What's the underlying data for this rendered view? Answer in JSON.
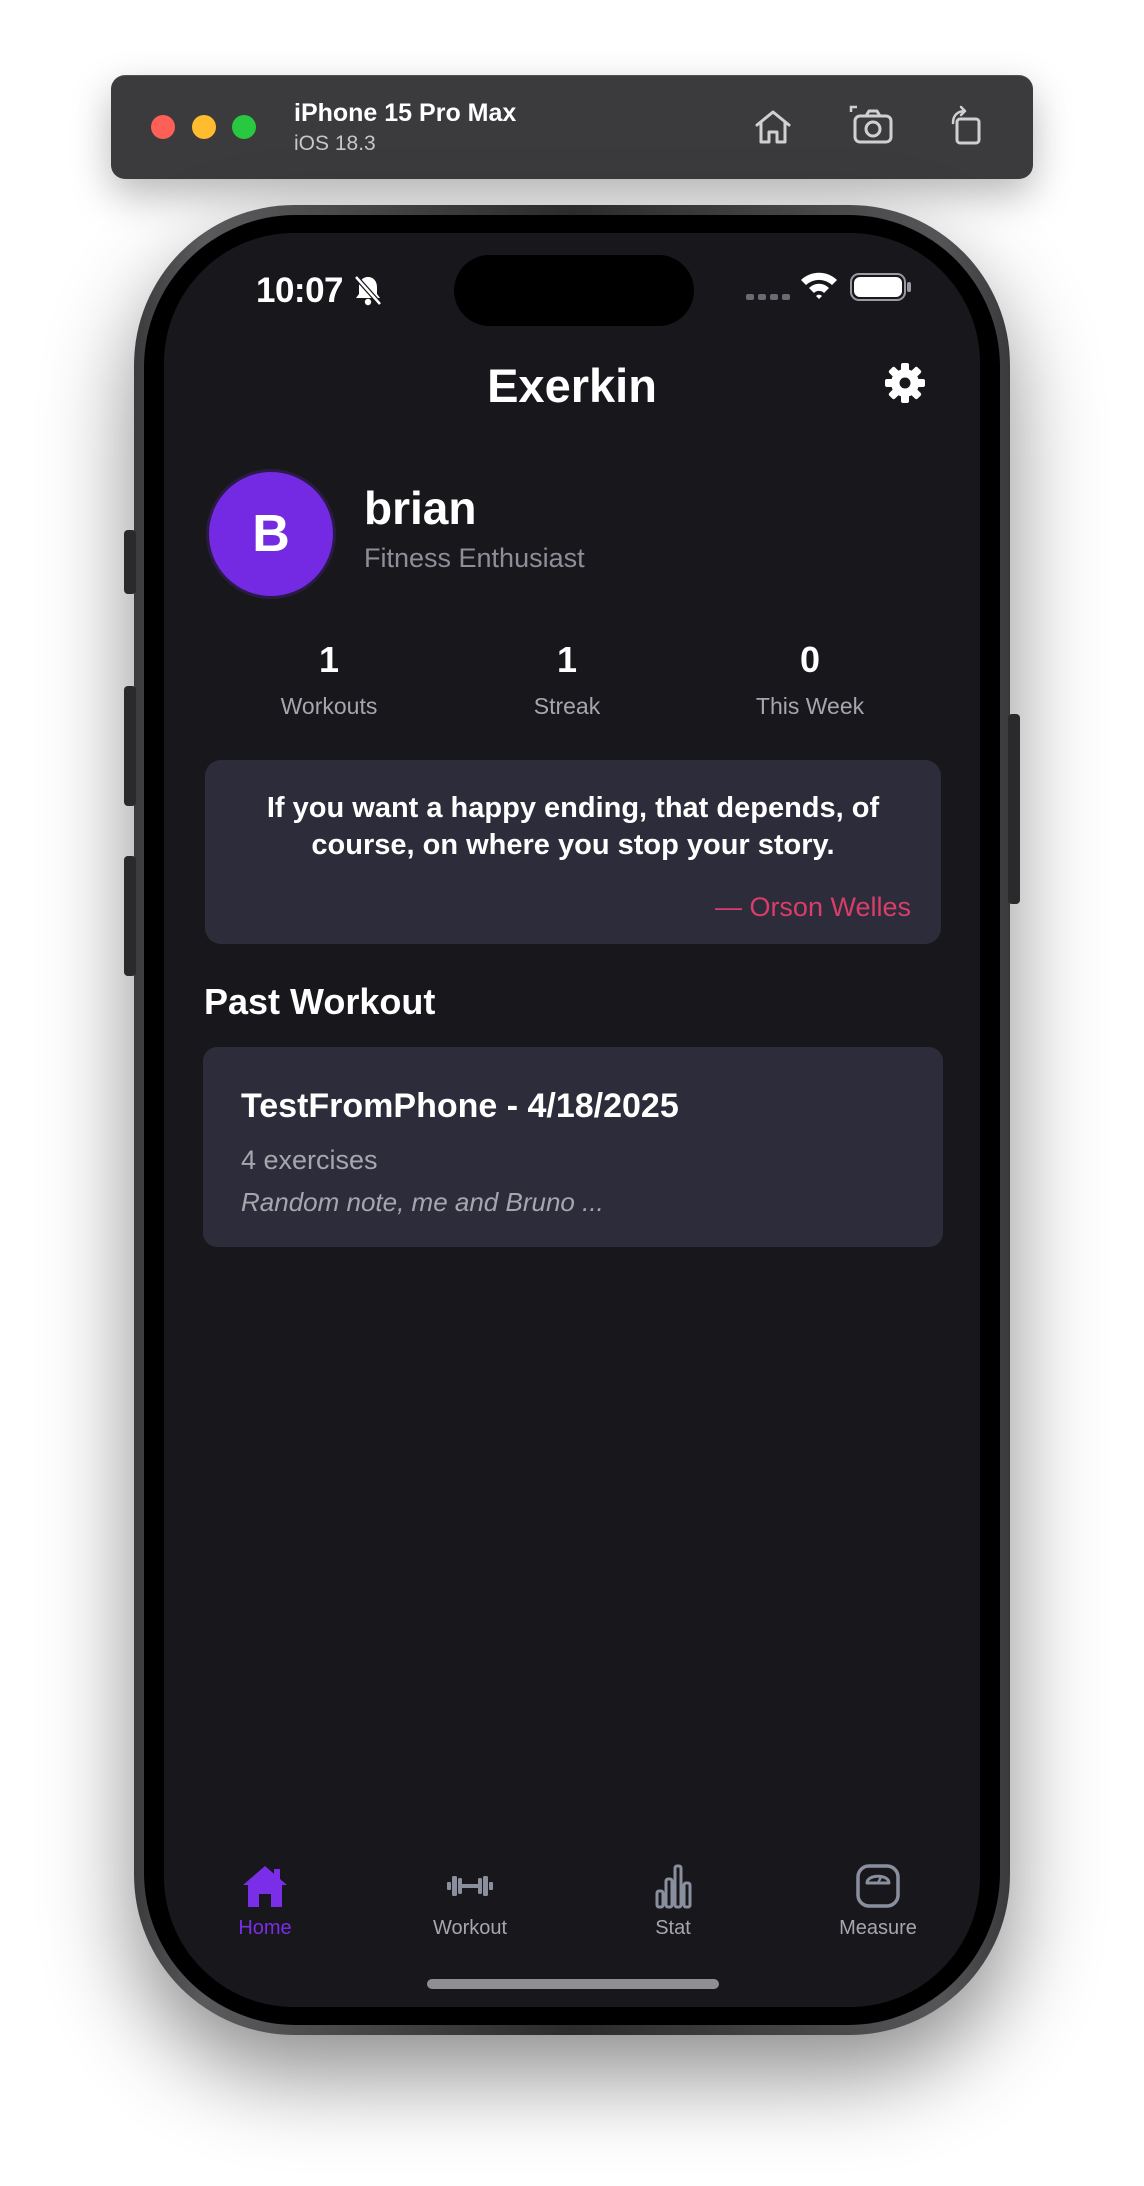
{
  "simulator": {
    "device_name": "iPhone 15 Pro Max",
    "os_version": "iOS 18.3",
    "buttons": [
      "home-icon",
      "screenshot-icon",
      "rotate-icon"
    ]
  },
  "status_bar": {
    "time": "10:07",
    "icons": [
      "bell-slash-icon",
      "cellular-icon",
      "wifi-icon",
      "battery-icon"
    ]
  },
  "header": {
    "title": "Exerkin",
    "settings_icon": "gear-icon"
  },
  "profile": {
    "avatar_initial": "B",
    "name": "brian",
    "tagline": "Fitness Enthusiast",
    "avatar_color": "#7429e3"
  },
  "stats": [
    {
      "value": "1",
      "label": "Workouts"
    },
    {
      "value": "1",
      "label": "Streak"
    },
    {
      "value": "0",
      "label": "This Week"
    }
  ],
  "quote": {
    "text": "If you want a happy ending, that depends, of course, on where you stop your story.",
    "author": "— Orson Welles",
    "author_color": "#d93d6a"
  },
  "past_workout": {
    "section_title": "Past Workout",
    "title": "TestFromPhone - 4/18/2025",
    "exercise_count": "4 exercises",
    "note": "Random note, me and Bruno ..."
  },
  "tabs": [
    {
      "label": "Home",
      "icon": "home-icon",
      "active": true
    },
    {
      "label": "Workout",
      "icon": "dumbbell-icon",
      "active": false
    },
    {
      "label": "Stat",
      "icon": "bar-chart-icon",
      "active": false
    },
    {
      "label": "Measure",
      "icon": "scale-icon",
      "active": false
    }
  ],
  "colors": {
    "background": "#18171c",
    "card": "#2d2c3a",
    "accent": "#7a2ee8"
  }
}
